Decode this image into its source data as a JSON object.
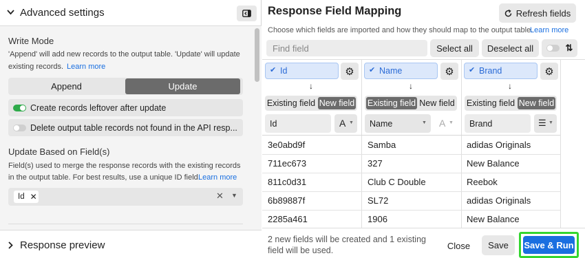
{
  "left": {
    "header": {
      "title": "Advanced settings"
    },
    "write_mode": {
      "title": "Write Mode",
      "desc_line1": "'Append' will add new records to the output table. 'Update' will update",
      "desc_line2": "existing records.",
      "learn_more": "Learn more",
      "append_label": "Append",
      "update_label": "Update",
      "option1_label": "Create records leftover after update",
      "option1_on": true,
      "option2_label": "Delete output table records not found in the API resp...",
      "option2_on": false
    },
    "update_based": {
      "title": "Update Based on Field(s)",
      "desc_line1": "Field(s) used to merge the response records with the existing records",
      "desc_line2": "in the output table. For best results, use a unique ID field.",
      "learn_more": "Learn more",
      "tag_label": "Id"
    },
    "footer": {
      "title": "Response preview"
    }
  },
  "right": {
    "title": "Response Field Mapping",
    "refresh_label": "Refresh fields",
    "subtitle": "Choose which fields are imported and how they should map to the output table.",
    "subtitle_link": "Learn more",
    "find_placeholder": "Find field",
    "select_all": "Select all",
    "deselect_all": "Deselect all",
    "columns": [
      {
        "name": "Id",
        "existing_label": "Existing field",
        "new_label": "New field",
        "selected": "new",
        "field_name": "Id",
        "type_icon": "A"
      },
      {
        "name": "Name",
        "existing_label": "Existing field",
        "new_label": "New field",
        "selected": "existing",
        "field_name": "Name",
        "type_icon": "A"
      },
      {
        "name": "Brand",
        "existing_label": "Existing field",
        "new_label": "New field",
        "selected": "new",
        "field_name": "Brand",
        "type_icon": "list"
      }
    ],
    "rows": [
      [
        "3e0abd9f",
        "Samba",
        "adidas Originals"
      ],
      [
        "711ec673",
        "327",
        "New Balance"
      ],
      [
        "811c0d31",
        "Club C Double",
        "Reebok"
      ],
      [
        "6b89887f",
        "SL72",
        "adidas Originals"
      ],
      [
        "2285a461",
        "1906",
        "New Balance"
      ]
    ],
    "footer": {
      "info_line1": "2 new fields will be created and 1 existing",
      "info_line2": "field will be used.",
      "close": "Close",
      "save": "Save",
      "save_run": "Save & Run"
    }
  },
  "colors": {
    "accent": "#1a6fe0",
    "toggle_on": "#2eaa4a",
    "dark_btn": "#6b6b6b",
    "highlight": "#33d62f"
  }
}
